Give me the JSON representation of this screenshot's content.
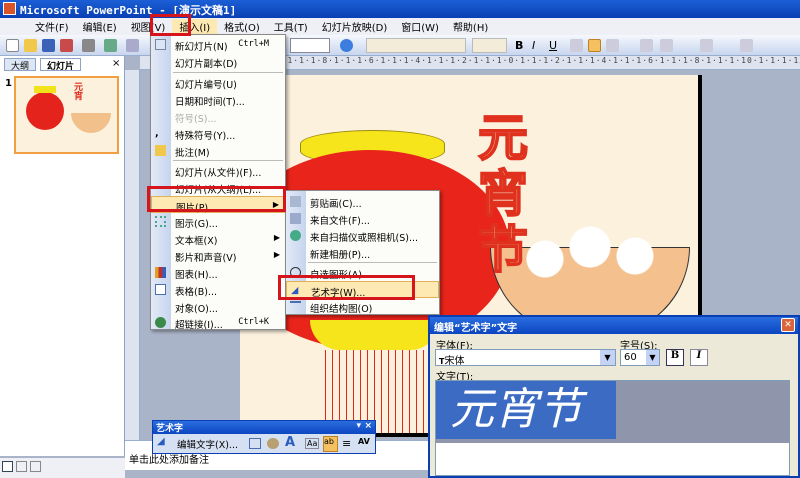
{
  "window": {
    "title": "Microsoft PowerPoint - [演示文稿1]"
  },
  "menubar": [
    "文件(F)",
    "编辑(E)",
    "视图(V)",
    "插入(I)",
    "格式(O)",
    "工具(T)",
    "幻灯片放映(D)",
    "窗口(W)",
    "帮助(H)"
  ],
  "leftpane": {
    "tabs": [
      "大纲",
      "幻灯片"
    ],
    "close": "×",
    "slide_number": "1"
  },
  "ruler": "10·1·1·1·8·1·1·1·6·1·1·1·4·1·1·1·2·1·1·1·0·1·1·1·2·1·1·1·4·1·1·1·6·1·1·1·8·1·1·1·10·1·1·1·12",
  "insert_menu": [
    {
      "label": "新幻灯片(N)",
      "shortcut": "Ctrl+M"
    },
    {
      "label": "幻灯片副本(D)"
    },
    {
      "label": "幻灯片编号(U)"
    },
    {
      "label": "日期和时间(T)..."
    },
    {
      "label": "符号(S)..."
    },
    {
      "label": "特殊符号(Y)..."
    },
    {
      "label": "批注(M)"
    },
    {
      "label": "幻灯片(从文件)(F)..."
    },
    {
      "label": "幻灯片(从大纲)(L)..."
    },
    {
      "label": "图片(P)"
    },
    {
      "label": "图示(G)..."
    },
    {
      "label": "文本框(X)"
    },
    {
      "label": "影片和声音(V)"
    },
    {
      "label": "图表(H)..."
    },
    {
      "label": "表格(B)..."
    },
    {
      "label": "对象(O)..."
    },
    {
      "label": "超链接(I)...",
      "shortcut": "Ctrl+K"
    }
  ],
  "picture_submenu": [
    "剪贴画(C)...",
    "来自文件(F)...",
    "来自扫描仪或照相机(S)...",
    "新建相册(P)...",
    "自选图形(A)",
    "艺术字(W)...",
    "组织结构图(O)"
  ],
  "slide": {
    "wordart": "元宵节"
  },
  "notes": {
    "placeholder": "单击此处添加备注"
  },
  "dialog": {
    "title": "编辑“艺术字”文字",
    "font_label": "字体(F):",
    "font_value": "宋体",
    "size_label": "字号(S):",
    "size_value": "60",
    "bold": "B",
    "italic": "I",
    "text_label": "文字(T):",
    "text_value": "元宵节"
  },
  "wordart_toolbar": {
    "title": "艺术字",
    "edit_text": "编辑文字(X)...",
    "close": "×"
  },
  "colors": {
    "highlight": "#d6141b",
    "title_blue": "#0a3fb4",
    "menu_hover": "#ffe9b3"
  }
}
